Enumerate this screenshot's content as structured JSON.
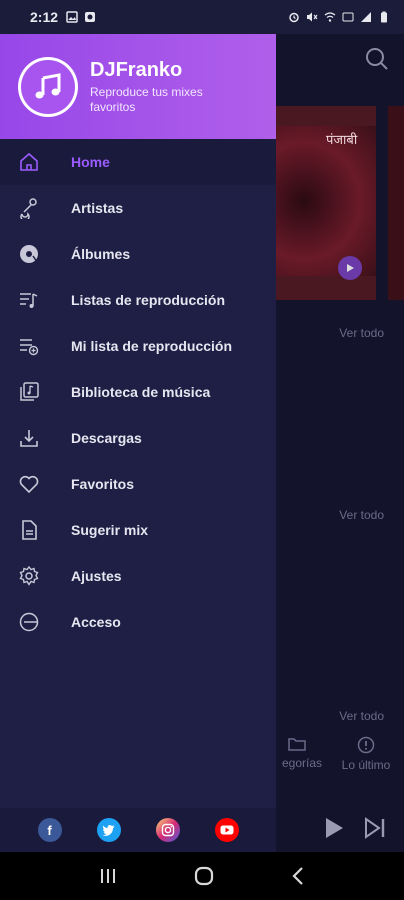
{
  "status_bar": {
    "time": "2:12"
  },
  "drawer": {
    "app_name": "DJFranko",
    "tagline": "Reproduce tus mixes favoritos",
    "menu": [
      {
        "label": "Home",
        "icon": "home-icon",
        "active": true
      },
      {
        "label": "Artistas",
        "icon": "artist-icon"
      },
      {
        "label": "Álbumes",
        "icon": "album-icon"
      },
      {
        "label": "Listas de reproducción",
        "icon": "playlist-icon"
      },
      {
        "label": "Mi lista de reproducción",
        "icon": "my-playlist-icon"
      },
      {
        "label": "Biblioteca de música",
        "icon": "music-library-icon"
      },
      {
        "label": "Descargas",
        "icon": "download-icon"
      },
      {
        "label": "Favoritos",
        "icon": "heart-icon"
      },
      {
        "label": "Sugerir mix",
        "icon": "document-icon"
      },
      {
        "label": "Ajustes",
        "icon": "gear-icon"
      },
      {
        "label": "Acceso",
        "icon": "logout-icon"
      }
    ],
    "social": [
      {
        "name": "facebook-icon",
        "glyph": "f",
        "color": "#3b5998"
      },
      {
        "name": "twitter-icon",
        "glyph": "t",
        "color": "#1da1f2"
      },
      {
        "name": "instagram-icon",
        "glyph": "◎",
        "color": "#d6249f"
      },
      {
        "name": "youtube-icon",
        "glyph": "▶",
        "color": "#ff0000"
      }
    ]
  },
  "background": {
    "card_text": "पंजाबी",
    "ver_todo": "Ver todo",
    "tab_categorias": "egorías",
    "tab_lo_ultimo": "Lo último"
  },
  "colors": {
    "accent": "#9b5cff",
    "header_start": "#9747e8",
    "header_end": "#b05fea",
    "drawer_bg": "#1f1f45"
  }
}
